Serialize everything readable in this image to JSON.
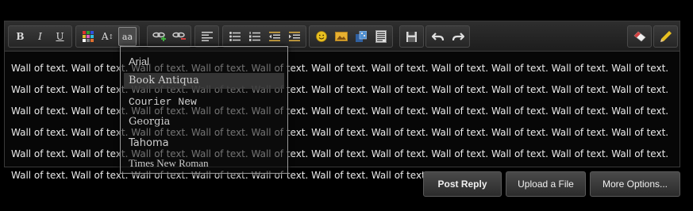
{
  "toolbar": {
    "bold": "B",
    "italic": "I",
    "underline": "U",
    "font_size": "A",
    "font_size_arrows": "↕",
    "font_family": "a",
    "font_family_alt": "a"
  },
  "content": {
    "text": "Wall of text. Wall of text. Wall of text. Wall of text. Wall of text. Wall of text. Wall of text. Wall of text. Wall of text. Wall of text. Wall of text. Wall of text. Wall of text. Wall of text. Wall of text. Wall of text. Wall of text. Wall of text. Wall of text. Wall of text. Wall of text. Wall of text. Wall of text. Wall of text. Wall of text. Wall of text. Wall of text. Wall of text. Wall of text. Wall of text. Wall of text. Wall of text. Wall of text. Wall of text. Wall of text. Wall of text. Wall of text. Wall of text. Wall of text. Wall of text. Wall of text. Wall of text. Wall of text. Wall of text. Wall of text. Wall of text. Wall of text. Wall of text. Wall of text. Wall of text. Wall of text. Wall of text. Wall of text. Wall of text. Wall of text. Wall of text. Wall of text. Wall of text. Wall of text. Wall of text. Wall of text. Wall of text."
  },
  "font_menu": {
    "options": [
      "Arial",
      "Book Antiqua",
      "Courier New",
      "Georgia",
      "Tahoma",
      "Times New Roman"
    ],
    "hovered": "Book Antiqua"
  },
  "actions": {
    "post_reply": "Post Reply",
    "upload_file": "Upload a File",
    "more_options": "More Options..."
  },
  "colors": {
    "background": "#000000",
    "toolbar": "#262626",
    "text": "#eaeaea",
    "emoji": "#e8c020",
    "remove_link": "#d04040",
    "add_link": "#40b040"
  }
}
